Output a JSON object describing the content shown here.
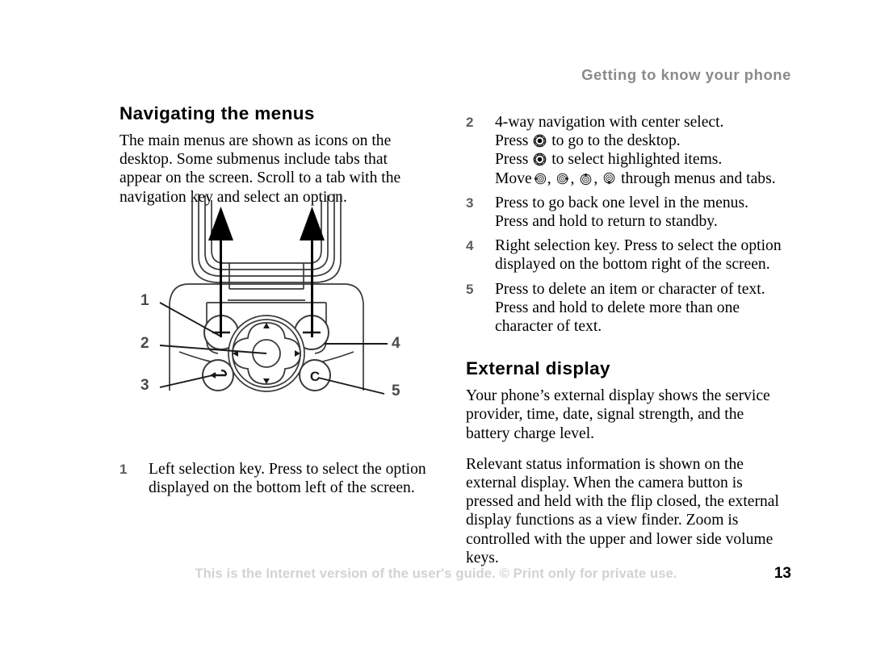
{
  "header": {
    "running_title": "Getting to know your phone"
  },
  "left_column": {
    "title": "Navigating the menus",
    "intro_lines": [
      "The main menus are shown as icons on the desktop.",
      "Some submenus include tabs that appear on the",
      "screen. Scroll to a tab with the navigation key and",
      "select an option."
    ],
    "list": [
      {
        "number": "1",
        "lines": [
          "Left selection key. Press to select the option",
          "displayed on the bottom left of the screen."
        ]
      }
    ]
  },
  "right_column": {
    "list": [
      {
        "number": "2",
        "lines": [
          "4-way navigation with center select.",
          "Press [center] to go to the desktop.",
          "Press [center] to select highlighted items.",
          "Move [left], [right], [up], [down] through menus and tabs."
        ],
        "plain_lines": [
          "4-way navigation with center select.",
          "Press  to go to the desktop.",
          "Press  to select highlighted items.",
          "Move , , ,  through menus and tabs."
        ],
        "line2_before": "Press",
        "line2_after": "to go to the desktop.",
        "line3_before": "Press",
        "line3_after": "to select highlighted items.",
        "line4_before": "Move",
        "line4_after": "through menus and tabs."
      },
      {
        "number": "3",
        "lines": [
          "Press to go back one level in the menus.",
          "Press and hold to return to standby."
        ]
      },
      {
        "number": "4",
        "lines": [
          "Right selection key. Press to select the option",
          "displayed on the bottom right of the screen."
        ]
      },
      {
        "number": "5",
        "lines": [
          "Press to delete an item or character of text.",
          "Press and hold to delete more than one",
          "character of text."
        ]
      }
    ],
    "section2": {
      "title": "External display",
      "paragraphs": [
        [
          "Your phone’s external display shows the service",
          "provider, time, date, signal strength, and the battery",
          "charge level."
        ],
        [
          "Relevant status information is shown on the external",
          "display. When the camera button is pressed and",
          "held with the flip closed, the external display",
          "functions as a view finder. Zoom is controlled",
          "with the upper and lower side volume keys."
        ]
      ]
    }
  },
  "diagram": {
    "description": "Lower half of a flip phone keypad with callouts",
    "callouts": [
      {
        "number": "1",
        "target": "left-selection-key"
      },
      {
        "number": "2",
        "target": "navigation-key"
      },
      {
        "number": "3",
        "target": "back-key"
      },
      {
        "number": "4",
        "target": "right-selection-key"
      },
      {
        "number": "5",
        "target": "clear-key"
      }
    ],
    "keys": {
      "clear_key_label": "C"
    }
  },
  "footer": {
    "note": "This is the Internet version of the user's guide. © Print only for private use.",
    "page_number": "13"
  },
  "colors": {
    "header_gray": "#8a8a8a",
    "callout_gray": "#5d5d5d",
    "footer_gray": "#d2d2d2",
    "ink": "#000000",
    "diagram_line": "#3a3a3a"
  }
}
